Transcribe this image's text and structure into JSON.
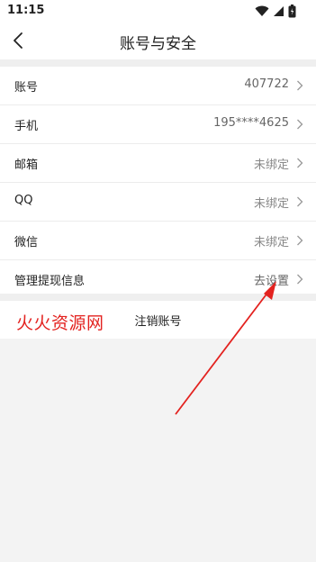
{
  "status": {
    "time": "11:15"
  },
  "header": {
    "title": "账号与安全"
  },
  "rows": [
    {
      "label": "账号",
      "value": "407722"
    },
    {
      "label": "手机",
      "value": "195****4625"
    },
    {
      "label": "邮箱",
      "value": "未绑定"
    },
    {
      "label": "QQ",
      "value": "未绑定"
    },
    {
      "label": "微信",
      "value": "未绑定"
    },
    {
      "label": "管理提现信息",
      "value": "去设置"
    }
  ],
  "cancel_account": {
    "label": "注销账号"
  },
  "watermark": {
    "text": "火火资源网"
  },
  "colors": {
    "annotation": "#e3221f",
    "watermark": "#e3221f"
  },
  "icons": [
    "wifi-icon",
    "signal-icon",
    "battery-icon",
    "back-arrow-icon",
    "chevron-right-icon"
  ]
}
